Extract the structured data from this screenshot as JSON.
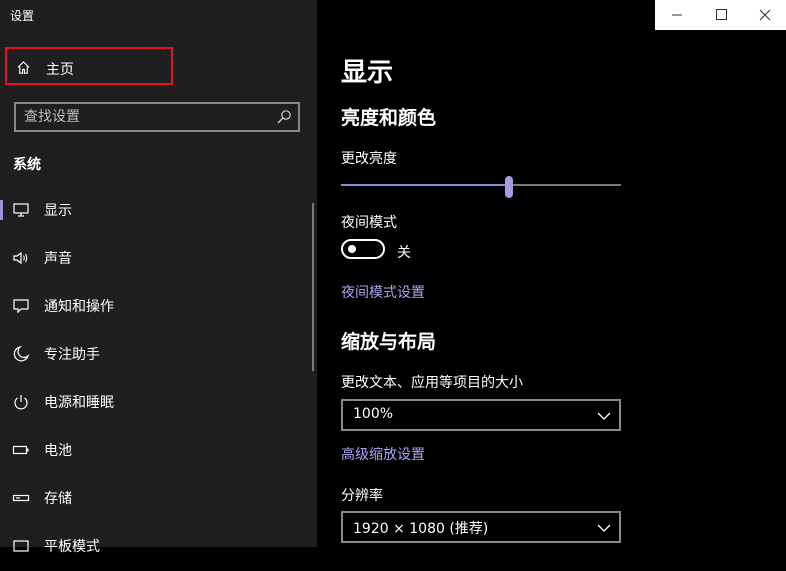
{
  "window": {
    "title": "设置",
    "controls": {
      "minimize_icon": "minimize-icon",
      "maximize_icon": "maximize-icon",
      "close_icon": "close-icon"
    }
  },
  "sidebar": {
    "home": {
      "label": "主页",
      "icon": "home-icon"
    },
    "search": {
      "placeholder": "查找设置",
      "icon": "search-icon"
    },
    "section": "系统",
    "items": [
      {
        "label": "显示",
        "icon": "monitor-icon",
        "selected": true
      },
      {
        "label": "声音",
        "icon": "speaker-icon"
      },
      {
        "label": "通知和操作",
        "icon": "notification-icon"
      },
      {
        "label": "专注助手",
        "icon": "moon-icon"
      },
      {
        "label": "电源和睡眠",
        "icon": "power-icon"
      },
      {
        "label": "电池",
        "icon": "battery-icon"
      },
      {
        "label": "存储",
        "icon": "storage-icon"
      },
      {
        "label": "平板模式",
        "icon": "tablet-icon"
      }
    ]
  },
  "main": {
    "title": "显示",
    "brightness_section": {
      "heading": "亮度和颜色",
      "brightness_label": "更改亮度",
      "brightness_value": 0.6,
      "night_mode_label": "夜间模式",
      "night_mode_state": "关",
      "night_mode_link": "夜间模式设置"
    },
    "scale_section": {
      "heading": "缩放与布局",
      "scale_label": "更改文本、应用等项目的大小",
      "scale_value": "100%",
      "advanced_link": "高级缩放设置",
      "resolution_label": "分辨率",
      "resolution_value": "1920 × 1080 (推荐)"
    }
  },
  "colors": {
    "accent": "#9a95dd",
    "highlight_border": "#e81123",
    "link": "#a9a3f0"
  }
}
